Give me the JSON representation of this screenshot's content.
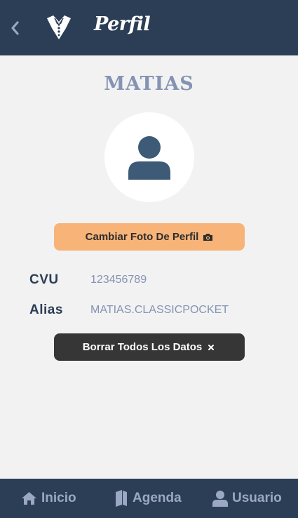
{
  "header": {
    "title": "Perfil",
    "back_icon": "chevron-left-icon",
    "logo_icon": "tuxedo-icon"
  },
  "profile": {
    "name": "MATIAS",
    "avatar_icon": "user-icon",
    "change_photo_label": "Cambiar Foto De Perfil",
    "change_photo_icon": "camera-icon",
    "cvu_label": "CVU",
    "cvu_value": "123456789",
    "alias_label": "Alias",
    "alias_value": "MATIAS.CLASSICPOCKET",
    "delete_label": "Borrar Todos Los Datos",
    "delete_icon": "close-icon"
  },
  "nav": {
    "items": [
      {
        "label": "Inicio",
        "icon": "home-icon"
      },
      {
        "label": "Agenda",
        "icon": "book-icon"
      },
      {
        "label": "Usuario",
        "icon": "user-icon"
      }
    ]
  },
  "colors": {
    "header_bg": "#2c3e55",
    "page_bg": "#f2f2f2",
    "accent_orange": "#f8b378",
    "dark_button": "#363636",
    "muted_text": "#8493b4"
  }
}
